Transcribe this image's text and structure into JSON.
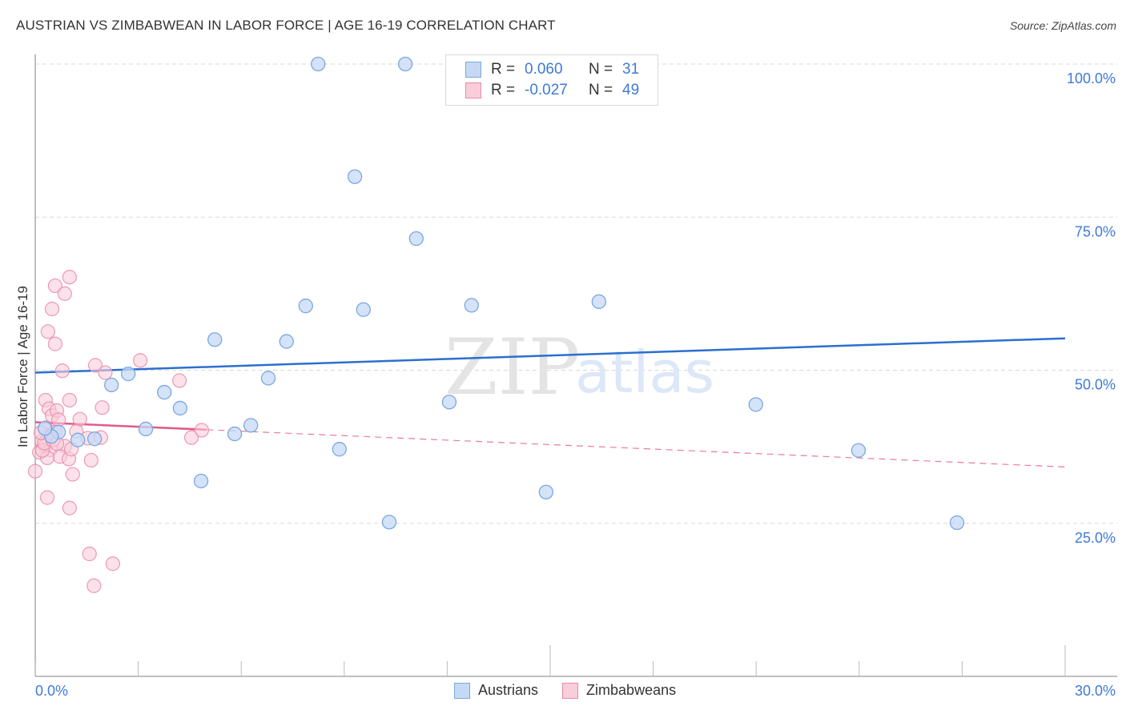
{
  "header": {
    "title": "AUSTRIAN VS ZIMBABWEAN IN LABOR FORCE | AGE 16-19 CORRELATION CHART",
    "source": "Source: ZipAtlas.com"
  },
  "legend": {
    "rows": [
      {
        "series": "Austrians",
        "r_label": "R =",
        "r_value": "0.060",
        "n_label": "N =",
        "n_value": "31"
      },
      {
        "series": "Zimbabweans",
        "r_label": "R =",
        "r_value": "-0.027",
        "n_label": "N =",
        "n_value": "49"
      }
    ]
  },
  "bottom_legend": [
    "Austrians",
    "Zimbabweans"
  ],
  "watermark": {
    "part1": "ZIP",
    "part2": "atlas"
  },
  "colors": {
    "blue_fill": "#c5d9f5",
    "blue_stroke": "#7aa7e3",
    "blue_line": "#2b6fd0",
    "pink_fill": "#f9cdda",
    "pink_stroke": "#e98aa8",
    "pink_line": "#e35a8a",
    "axis_text": "#3f7ad6"
  },
  "chart_data": {
    "type": "scatter",
    "title": "AUSTRIAN VS ZIMBABWEAN IN LABOR FORCE | AGE 16-19 CORRELATION CHART",
    "xlabel": "",
    "ylabel": "In Labor Force | Age 16-19",
    "xlim": [
      0,
      30
    ],
    "ylim": [
      0,
      100
    ],
    "x_tick_labels": [
      {
        "value": 0,
        "label": "0.0%"
      },
      {
        "value": 30,
        "label": "30.0%"
      }
    ],
    "y_tick_labels": [
      {
        "value": 25,
        "label": "25.0%"
      },
      {
        "value": 50,
        "label": "50.0%"
      },
      {
        "value": 75,
        "label": "75.0%"
      },
      {
        "value": 100,
        "label": "100.0%"
      }
    ],
    "x_minor_ticks": [
      0,
      3,
      6,
      9,
      12,
      15,
      18,
      21,
      24,
      27,
      30
    ],
    "grid": "horizontal dashed",
    "legend_position": "top-center",
    "series": [
      {
        "name": "Austrians",
        "R": 0.06,
        "N": 31,
        "trend": {
          "x0": 0,
          "y0": 49.6,
          "x1": 30,
          "y1": 55.2,
          "style": "solid"
        },
        "points": [
          [
            8.24,
            100.0
          ],
          [
            10.78,
            100.0
          ],
          [
            9.31,
            81.6
          ],
          [
            11.1,
            71.5
          ],
          [
            7.88,
            60.5
          ],
          [
            9.56,
            59.9
          ],
          [
            12.71,
            60.6
          ],
          [
            16.42,
            61.2
          ],
          [
            5.23,
            55.0
          ],
          [
            7.32,
            54.7
          ],
          [
            6.79,
            48.7
          ],
          [
            2.71,
            49.4
          ],
          [
            2.22,
            47.6
          ],
          [
            3.76,
            46.4
          ],
          [
            4.22,
            43.8
          ],
          [
            12.06,
            44.8
          ],
          [
            20.99,
            44.4
          ],
          [
            3.22,
            40.4
          ],
          [
            5.81,
            39.6
          ],
          [
            6.28,
            41.0
          ],
          [
            0.68,
            39.9
          ],
          [
            1.24,
            38.6
          ],
          [
            1.73,
            38.8
          ],
          [
            8.86,
            37.1
          ],
          [
            23.98,
            36.9
          ],
          [
            14.88,
            30.1
          ],
          [
            4.83,
            31.9
          ],
          [
            10.31,
            25.2
          ],
          [
            26.85,
            25.1
          ],
          [
            0.47,
            39.2
          ],
          [
            0.28,
            40.5
          ]
        ]
      },
      {
        "name": "Zimbabweans",
        "R": -0.027,
        "N": 49,
        "trend": {
          "x0": 0,
          "y0": 41.5,
          "x1": 30,
          "y1": 34.2,
          "solid_until_x": 5.0,
          "style": "solid-then-dashed"
        },
        "points": [
          [
            1.0,
            65.2
          ],
          [
            0.58,
            63.8
          ],
          [
            0.86,
            62.5
          ],
          [
            0.49,
            60.0
          ],
          [
            0.37,
            56.3
          ],
          [
            0.58,
            54.3
          ],
          [
            0.79,
            49.9
          ],
          [
            1.75,
            50.8
          ],
          [
            2.04,
            49.6
          ],
          [
            3.06,
            51.6
          ],
          [
            4.2,
            48.3
          ],
          [
            0.3,
            45.1
          ],
          [
            1.0,
            45.1
          ],
          [
            0.4,
            43.7
          ],
          [
            0.49,
            42.6
          ],
          [
            0.63,
            43.4
          ],
          [
            1.3,
            42.0
          ],
          [
            1.95,
            43.9
          ],
          [
            0.68,
            41.9
          ],
          [
            0.3,
            40.6
          ],
          [
            1.2,
            40.0
          ],
          [
            0.4,
            39.4
          ],
          [
            0.58,
            39.9
          ],
          [
            0.19,
            38.4
          ],
          [
            0.28,
            37.6
          ],
          [
            0.44,
            37.0
          ],
          [
            0.12,
            36.6
          ],
          [
            0.86,
            37.6
          ],
          [
            1.53,
            38.9
          ],
          [
            0.72,
            35.9
          ],
          [
            0.35,
            35.7
          ],
          [
            0.98,
            35.5
          ],
          [
            1.63,
            35.3
          ],
          [
            1.91,
            39.0
          ],
          [
            4.55,
            39.0
          ],
          [
            4.85,
            40.2
          ],
          [
            0.0,
            33.5
          ],
          [
            1.09,
            33.0
          ],
          [
            0.35,
            29.2
          ],
          [
            1.0,
            27.5
          ],
          [
            1.58,
            20.0
          ],
          [
            2.26,
            18.4
          ],
          [
            1.71,
            14.8
          ],
          [
            0.21,
            36.9
          ],
          [
            0.26,
            38.1
          ],
          [
            0.16,
            39.8
          ],
          [
            0.51,
            38.6
          ],
          [
            1.05,
            37.1
          ],
          [
            0.63,
            38.0
          ]
        ]
      }
    ]
  }
}
